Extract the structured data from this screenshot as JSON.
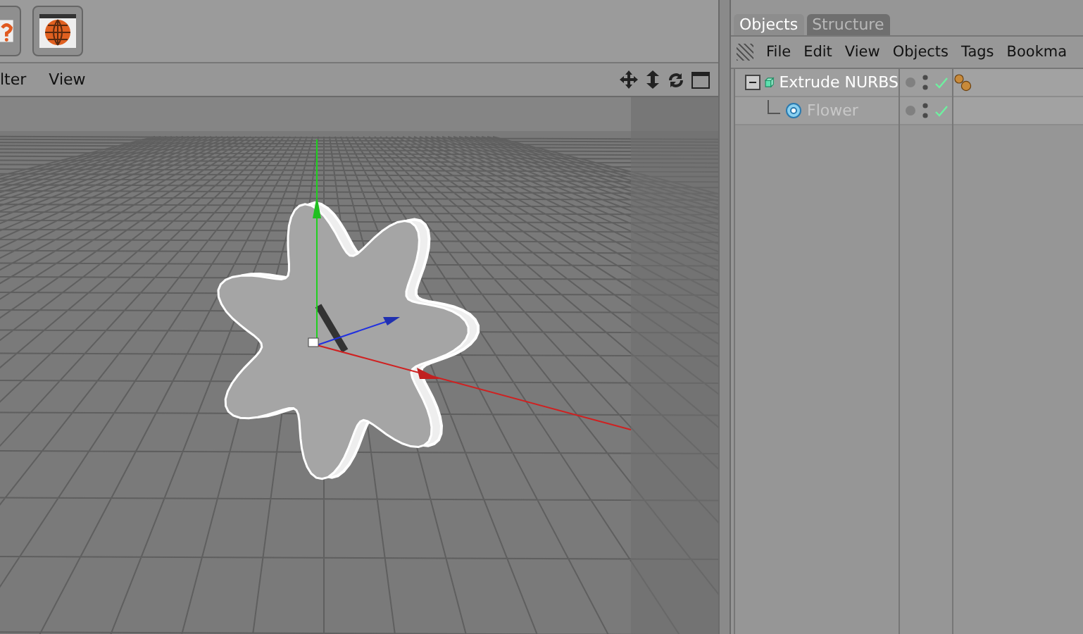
{
  "viewport": {
    "menu": [
      "lter",
      "View"
    ]
  },
  "object_manager": {
    "tabs": [
      {
        "label": "Objects",
        "selected": true
      },
      {
        "label": "Structure",
        "selected": false
      }
    ],
    "menu": [
      "File",
      "Edit",
      "View",
      "Objects",
      "Tags",
      "Bookma"
    ],
    "objects": [
      {
        "name": "Extrude NURBS",
        "kind": "nurbs",
        "expanded": true,
        "greyed": false,
        "has_tag": true,
        "children": [
          {
            "name": "Flower",
            "kind": "spline",
            "greyed": true,
            "has_tag": false
          }
        ]
      }
    ]
  }
}
